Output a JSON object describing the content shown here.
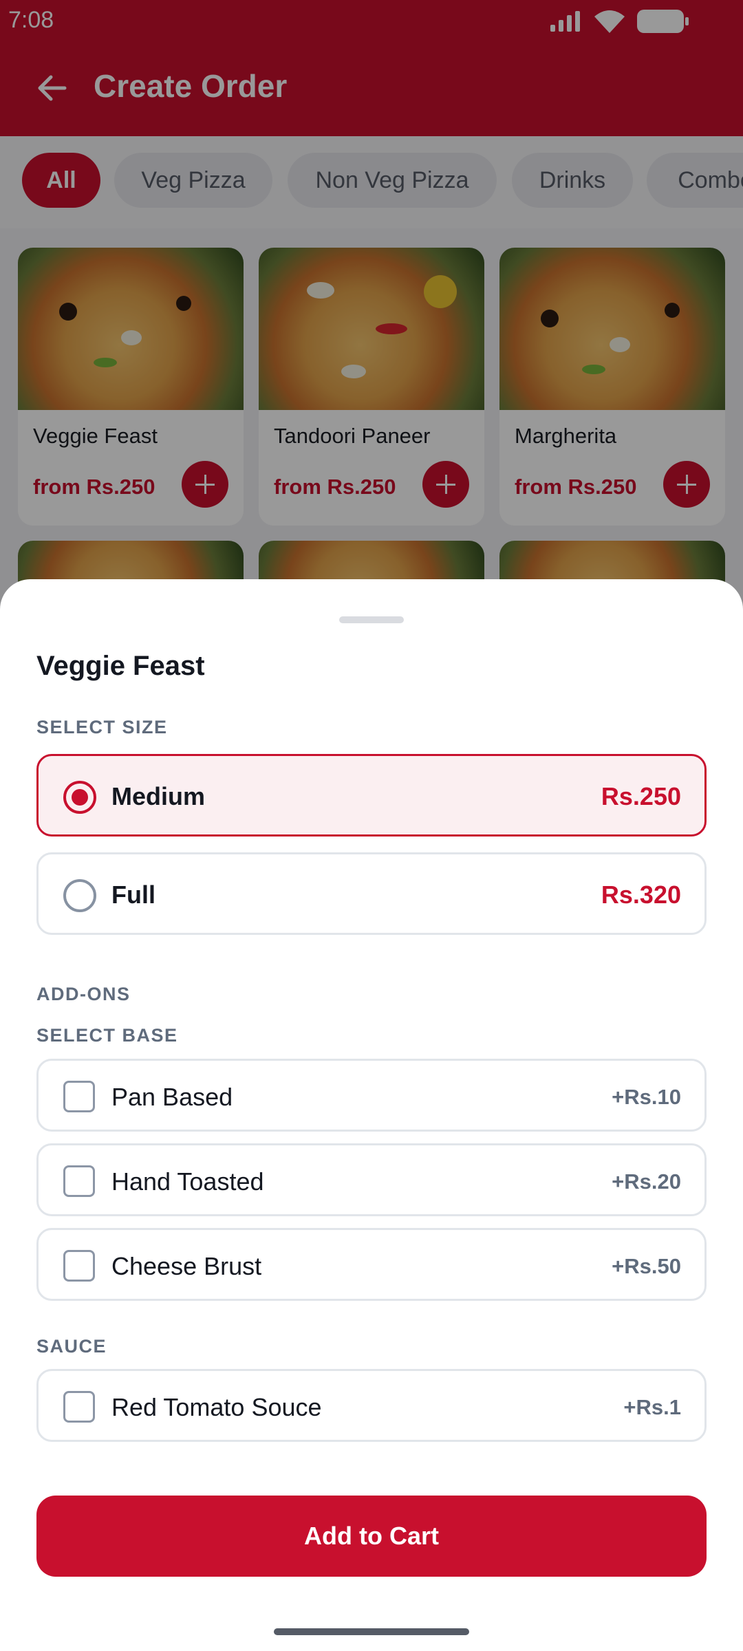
{
  "status_bar": {
    "time": "7:08"
  },
  "app_bar": {
    "title": "Create Order"
  },
  "categories": [
    "All",
    "Veg Pizza",
    "Non Veg Pizza",
    "Drinks",
    "Combo"
  ],
  "products": [
    {
      "name": "Veggie Feast",
      "price": "from Rs.250"
    },
    {
      "name": "Tandoori Paneer",
      "price": "from Rs.250"
    },
    {
      "name": "Margherita",
      "price": "from Rs.250"
    }
  ],
  "sheet": {
    "title": "Veggie Feast",
    "size_heading": "SELECT SIZE",
    "sizes": [
      {
        "label": "Medium",
        "price": "Rs.250",
        "selected": true
      },
      {
        "label": "Full",
        "price": "Rs.320",
        "selected": false
      }
    ],
    "addons_heading": "ADD-ONS",
    "base_heading": "SELECT BASE",
    "bases": [
      {
        "label": "Pan Based",
        "price": "+Rs.10",
        "checked": false
      },
      {
        "label": "Hand Toasted",
        "price": "+Rs.20",
        "checked": false
      },
      {
        "label": "Cheese Brust",
        "price": "+Rs.50",
        "checked": false
      }
    ],
    "sauce_heading": "SAUCE",
    "sauces": [
      {
        "label": "Red Tomato Souce",
        "price": "+Rs.1",
        "checked": false
      }
    ],
    "add_to_cart": "Add to Cart"
  },
  "colors": {
    "brand": "#c8102e"
  },
  "icons": {
    "back": "arrow-left-icon",
    "add": "plus-icon"
  }
}
